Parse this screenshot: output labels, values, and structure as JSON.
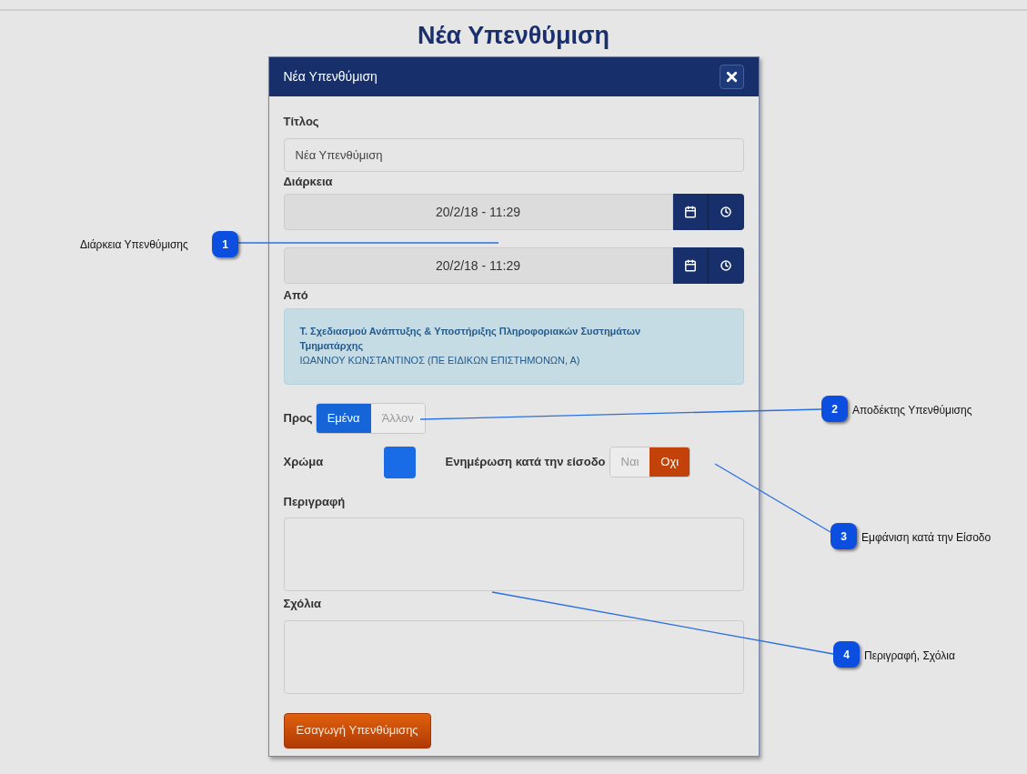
{
  "page_title": "Νέα Υπενθύμιση",
  "dialog": {
    "title": "Νέα Υπενθύμιση",
    "title_field": {
      "label": "Τίτλος",
      "value": "Νέα Υπενθύμιση"
    },
    "duration": {
      "label": "Διάρκεια",
      "ranges": [
        {
          "value": "20/2/18 - 11:29"
        },
        {
          "value": "20/2/18 - 11:29"
        }
      ]
    },
    "from": {
      "label": "Από",
      "lines": [
        {
          "text": "Τ. Σχεδιασμού Ανάπτυξης & Υποστήριξης Πληροφοριακών Συστημάτων",
          "bold": true
        },
        {
          "text": "Τμηματάρχης",
          "bold": true
        },
        {
          "text": "ΙΩΑΝΝΟΥ ΚΩΝΣΤΑΝΤΙΝΟΣ (ΠΕ ΕΙΔΙΚΩΝ ΕΠΙΣΤΗΜΟΝΩΝ, Α)",
          "bold": false
        }
      ]
    },
    "recipient": {
      "label": "Προς",
      "options": [
        {
          "label": "Εμένα",
          "selected": true
        },
        {
          "label": "Άλλον",
          "selected": false
        }
      ]
    },
    "color": {
      "label": "Χρώμα",
      "color": "#1a6be6"
    },
    "login_notify": {
      "label": "Ενημέρωση κατά την είσοδο",
      "options": [
        {
          "label": "Ναι",
          "selected": false
        },
        {
          "label": "Οχι",
          "selected": true
        }
      ]
    },
    "description": {
      "label": "Περιγραφή"
    },
    "comments": {
      "label": "Σχόλια"
    },
    "submit": "Εσαγωγή Υπενθύμισης"
  },
  "callouts": [
    {
      "number": "1",
      "text": "Διάρκεια Υπενθύμισης"
    },
    {
      "number": "2",
      "text": "Αποδέκτης Υπενθύμισης"
    },
    {
      "number": "3",
      "text": "Εμφάνιση κατά την Είσοδο"
    },
    {
      "number": "4",
      "text": "Περιγραφή, Σχόλια"
    }
  ]
}
